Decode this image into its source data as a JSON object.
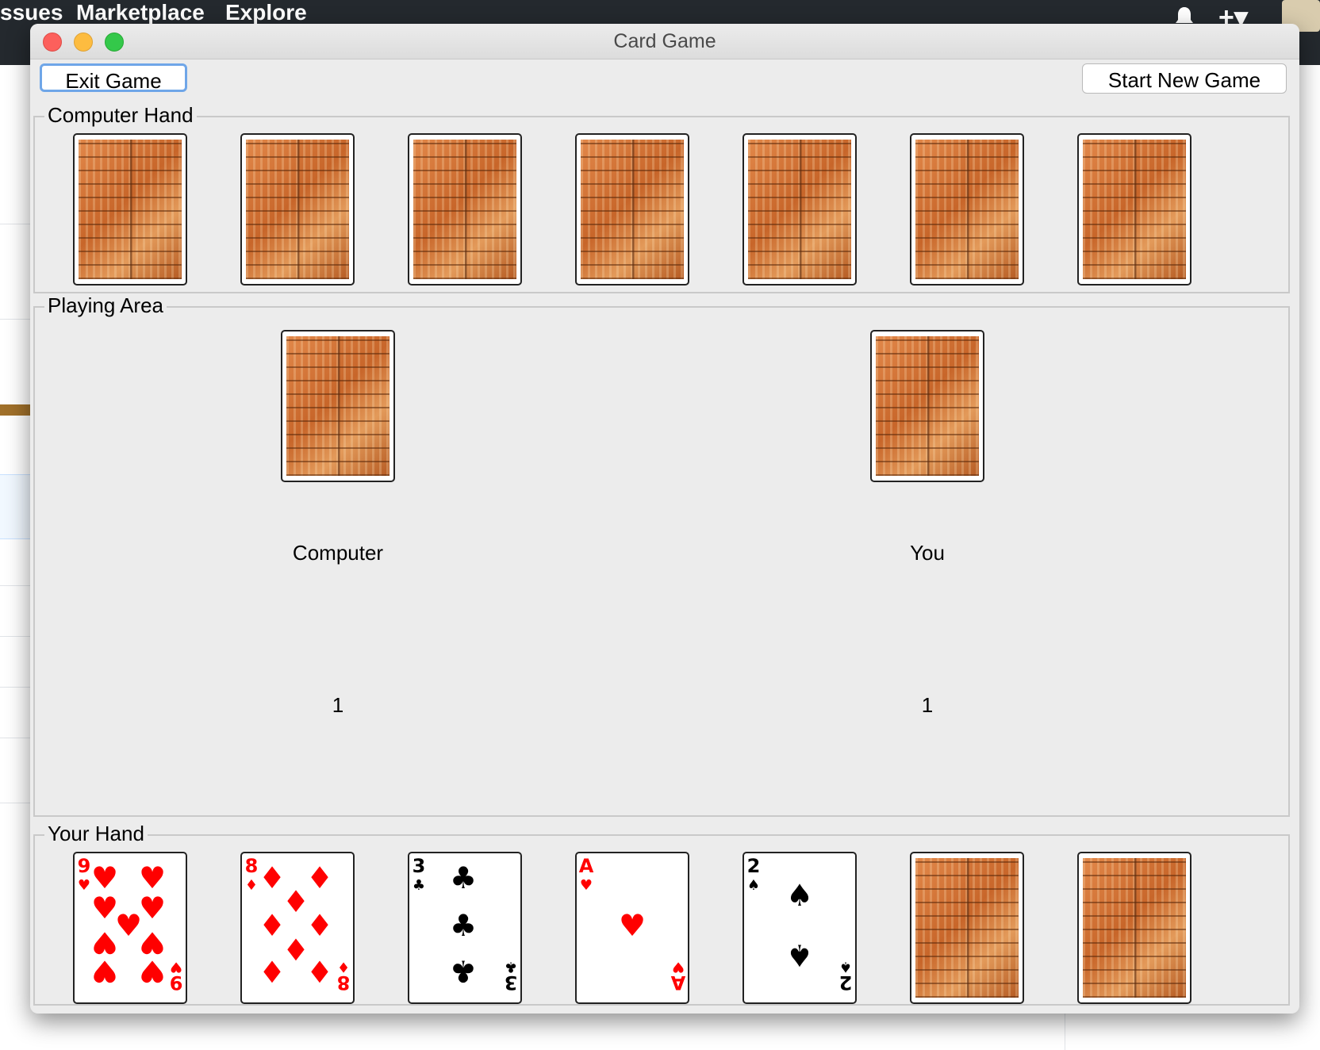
{
  "browser": {
    "nav": [
      "ssues",
      "Marketplace",
      "Explore"
    ],
    "plus_label": "+▾"
  },
  "window": {
    "title": "Card Game"
  },
  "toolbar": {
    "exit_label": "Exit Game",
    "new_game_label": "Start New Game"
  },
  "computer_hand": {
    "title": "Computer Hand",
    "cards": [
      "back",
      "back",
      "back",
      "back",
      "back",
      "back",
      "back"
    ]
  },
  "playing_area": {
    "title": "Playing Area",
    "computer_label": "Computer",
    "you_label": "You",
    "computer_score": "1",
    "you_score": "1",
    "computer_card": "back",
    "you_card": "back"
  },
  "your_hand": {
    "title": "Your Hand",
    "cards": [
      {
        "rank": "9",
        "suit": "hearts",
        "color": "#ff0000"
      },
      {
        "rank": "8",
        "suit": "diamonds",
        "color": "#ff0000"
      },
      {
        "rank": "3",
        "suit": "clubs",
        "color": "#000000"
      },
      {
        "rank": "A",
        "suit": "hearts",
        "color": "#ff0000"
      },
      {
        "rank": "2",
        "suit": "spades",
        "color": "#000000"
      },
      {
        "rank": "",
        "suit": "back",
        "color": ""
      },
      {
        "rank": "",
        "suit": "back",
        "color": ""
      }
    ]
  },
  "colors": {
    "window_bg": "#ececec",
    "focus_ring": "#6fa6e8",
    "red_suit": "#ff0000",
    "black_suit": "#000000"
  }
}
